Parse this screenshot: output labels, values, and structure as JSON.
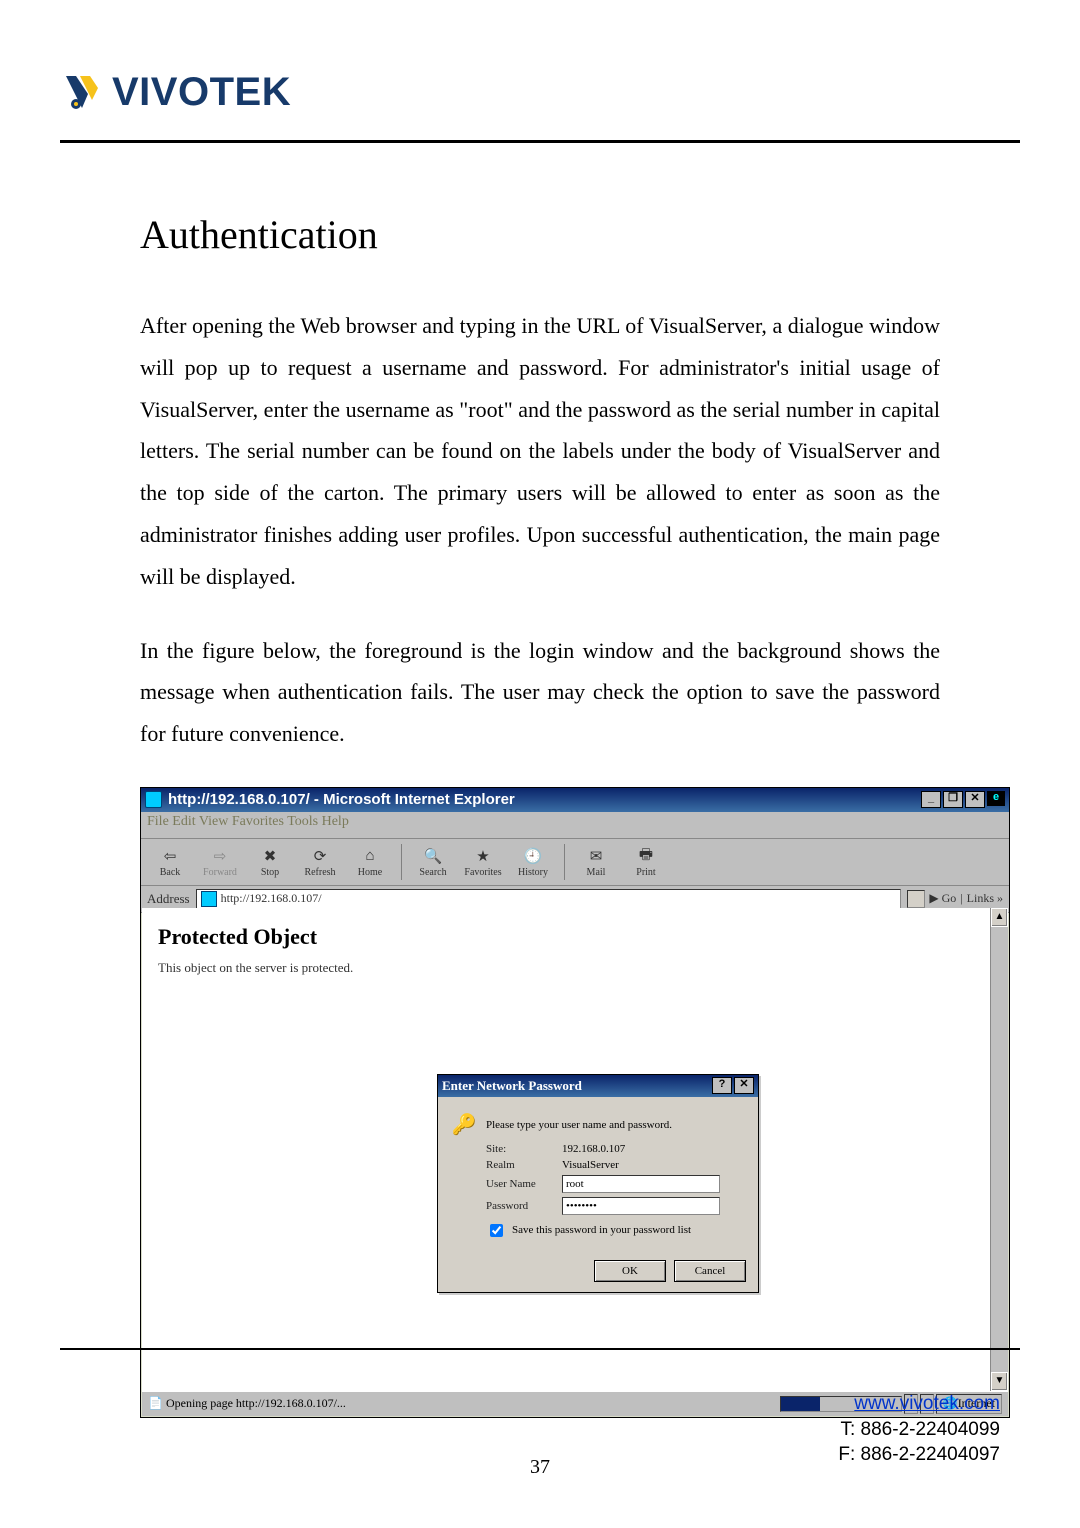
{
  "logo_text": "VIVOTEK",
  "heading": "Authentication",
  "para1": "After opening the Web browser and typing in the URL of VisualServer, a dialogue window will pop up to request a username and password. For administrator's initial usage of VisualServer, enter the username as \"root\" and the password as the serial number in capital letters. The serial number can be found on the labels under the body of VisualServer and the top side of the carton. The primary users will be allowed to enter as soon as the administrator finishes adding user profiles. Upon successful authentication, the main page will be displayed.",
  "para2": "In the figure below, the foreground is the login window and the background shows the message when authentication fails. The user may check the option to save the password for future convenience.",
  "ie": {
    "title": "http://192.168.0.107/ - Microsoft Internet Explorer",
    "menu": "File   Edit   View   Favorites   Tools   Help",
    "toolbar": [
      "Back",
      "Forward",
      "Stop",
      "Refresh",
      "Home",
      "Search",
      "Favorites",
      "History",
      "Mail",
      "Print"
    ],
    "address_label": "Address",
    "address_value": "http://192.168.0.107/",
    "go": "Go",
    "links": "Links »",
    "page_heading": "Protected Object",
    "page_text": "This object on the server is protected.",
    "status_left": "Opening page http://192.168.0.107/...",
    "status_right": "Internet"
  },
  "dialog": {
    "title": "Enter Network Password",
    "prompt": "Please type your user name and password.",
    "site_label": "Site:",
    "site_value": "192.168.0.107",
    "realm_label": "Realm",
    "realm_value": "VisualServer",
    "user_label": "User Name",
    "user_value": "root",
    "pass_label": "Password",
    "pass_value": "••••••••",
    "save_label": "Save this password in your password list",
    "ok": "OK",
    "cancel": "Cancel"
  },
  "page_number": "37",
  "footer": {
    "url": "www.vivotek.com",
    "tel": "T: 886-2-22404099",
    "fax": "F: 886-2-22404097"
  }
}
